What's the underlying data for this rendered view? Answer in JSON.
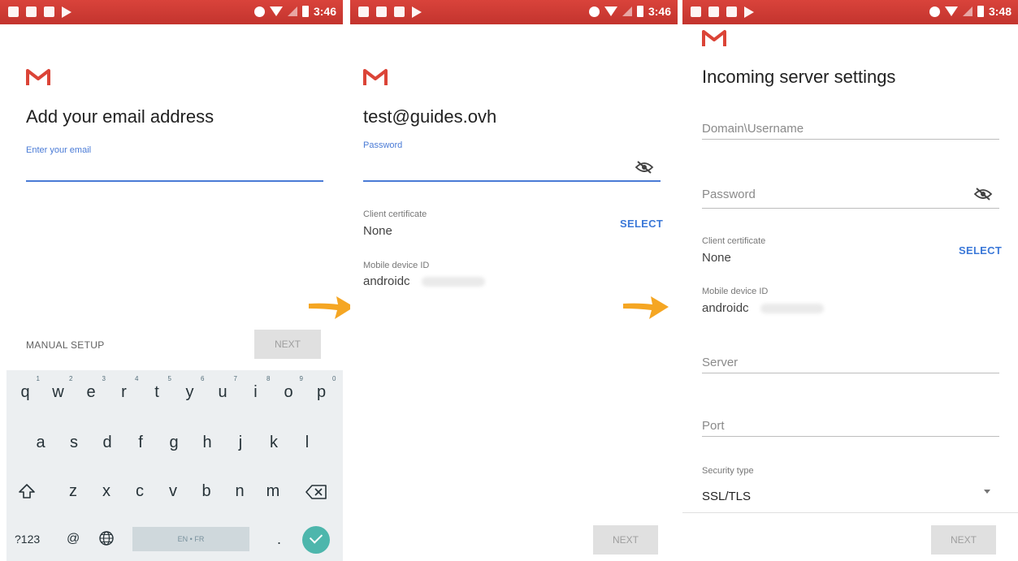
{
  "status": {
    "panel1_time": "3:46",
    "panel2_time": "3:46",
    "panel3_time": "3:48"
  },
  "panel1": {
    "title": "Add your email address",
    "email_hint": "Enter your email",
    "manual_setup": "MANUAL SETUP",
    "next": "NEXT"
  },
  "keyboard": {
    "row1": [
      "q",
      "w",
      "e",
      "r",
      "t",
      "y",
      "u",
      "i",
      "o",
      "p"
    ],
    "row1_hints": [
      "1",
      "2",
      "3",
      "4",
      "5",
      "6",
      "7",
      "8",
      "9",
      "0"
    ],
    "row2": [
      "a",
      "s",
      "d",
      "f",
      "g",
      "h",
      "j",
      "k",
      "l"
    ],
    "row3": [
      "z",
      "x",
      "c",
      "v",
      "b",
      "n",
      "m"
    ],
    "sym": "?123",
    "at": "@",
    "space_label": "EN • FR",
    "period": "."
  },
  "panel2": {
    "email": "test@guides.ovh",
    "password_hint": "Password",
    "client_cert_label": "Client certificate",
    "client_cert_value": "None",
    "select": "SELECT",
    "device_id_label": "Mobile device ID",
    "device_id_value": "androidc",
    "next": "NEXT"
  },
  "panel3": {
    "title": "Incoming server settings",
    "username_ph": "Domain\\Username",
    "password_ph": "Password",
    "client_cert_label": "Client certificate",
    "client_cert_value": "None",
    "select": "SELECT",
    "device_id_label": "Mobile device ID",
    "device_id_value": "androidc",
    "server_ph": "Server",
    "port_ph": "Port",
    "security_label": "Security type",
    "security_value": "SSL/TLS",
    "next": "NEXT"
  },
  "colors": {
    "status_bar": "#c3342e",
    "accent": "#4a7bd6",
    "arrow": "#f5a623",
    "gmail_red": "#db4437"
  },
  "icons": [
    "gmail-icon",
    "eye-off-icon",
    "shift-icon",
    "backspace-icon",
    "globe-icon",
    "check-icon",
    "dropdown-caret-icon",
    "arrow-icon"
  ]
}
